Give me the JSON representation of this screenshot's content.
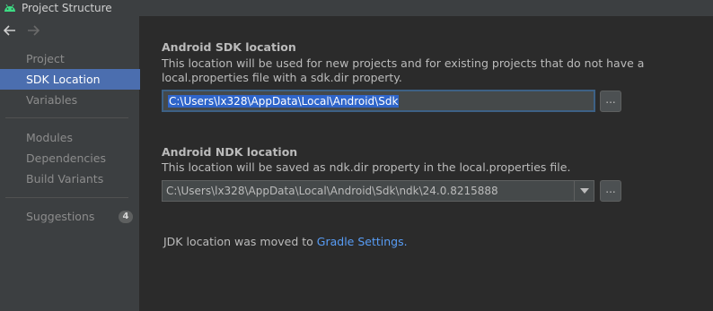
{
  "window": {
    "title": "Project Structure",
    "app_icon": "android-icon"
  },
  "nav": {
    "back_icon": "arrow-left-icon",
    "forward_icon": "arrow-right-icon"
  },
  "sidebar": {
    "items": [
      {
        "label": "Project",
        "selected": false
      },
      {
        "label": "SDK Location",
        "selected": true
      },
      {
        "label": "Variables",
        "selected": false
      },
      {
        "label": "Modules",
        "selected": false
      },
      {
        "label": "Dependencies",
        "selected": false
      },
      {
        "label": "Build Variants",
        "selected": false
      },
      {
        "label": "Suggestions",
        "selected": false,
        "badge": "4"
      }
    ]
  },
  "sdk": {
    "title": "Android SDK location",
    "description_line1": "This location will be used for new projects and for existing projects that do not have a",
    "description_line2": "local.properties file with a sdk.dir property.",
    "path": "C:\\Users\\lx328\\AppData\\Local\\Android\\Sdk",
    "browse_label": "..."
  },
  "ndk": {
    "title": "Android NDK location",
    "description": "This location will be saved as ndk.dir property in the local.properties file.",
    "path": "C:\\Users\\lx328\\AppData\\Local\\Android\\Sdk\\ndk\\24.0.8215888",
    "browse_label": "..."
  },
  "jdk": {
    "text": "JDK location was moved to",
    "link": "Gradle Settings."
  },
  "colors": {
    "selection": "#4b6eaf",
    "link": "#589df6",
    "background": "#2b2b2b",
    "sidebar": "#3c3f41"
  }
}
